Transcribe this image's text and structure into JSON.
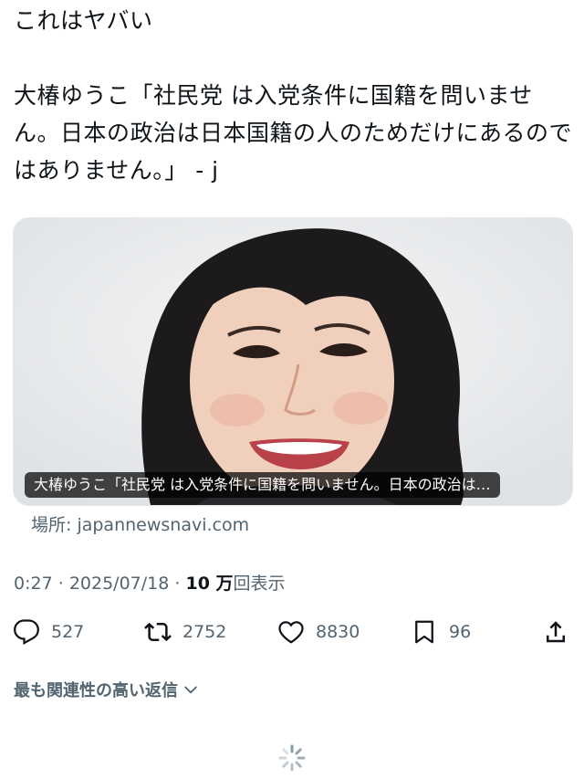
{
  "tweet": {
    "text_line1": "これはヤバい",
    "text_body": "大椿ゆうこ「社民党 は入党条件に国籍を問いません。日本の政治は日本国籍の人のためだけにあるのではありません。」 - j"
  },
  "card": {
    "caption": "大椿ゆうこ「社民党 は入党条件に国籍を問いません。日本の政治は…",
    "source": "場所: japannewsnavi.com"
  },
  "meta": {
    "time": "0:27",
    "separator": "·",
    "date": "2025/07/18",
    "views_count": "10 万",
    "views_label": "回表示"
  },
  "actions": {
    "reply_count": "527",
    "retweet_count": "2752",
    "like_count": "8830",
    "bookmark_count": "96"
  },
  "replies": {
    "sort_label": "最も関連性の高い返信"
  },
  "colors": {
    "text_primary": "#0f1419",
    "text_secondary": "#536471",
    "card_border": "#e3e7ea"
  },
  "icons": [
    "reply-icon",
    "retweet-icon",
    "like-icon",
    "bookmark-icon",
    "share-icon",
    "chevron-down-icon",
    "loading-spinner-icon"
  ]
}
